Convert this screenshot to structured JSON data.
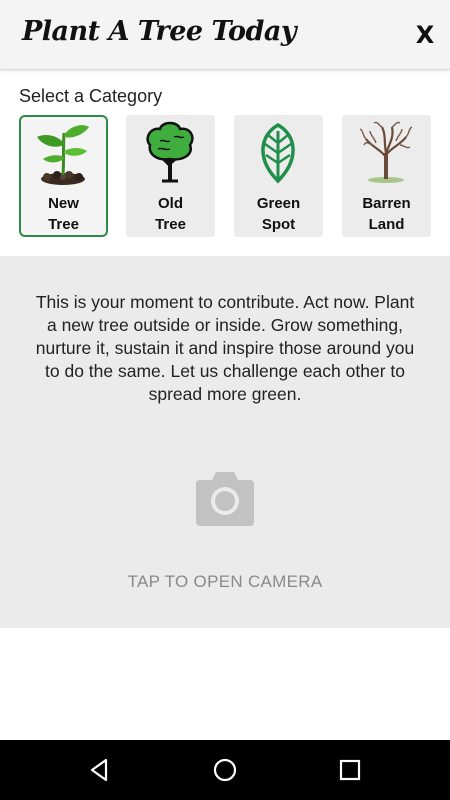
{
  "header": {
    "title": "Plant A Tree Today",
    "close_label": "X"
  },
  "category_section": {
    "label": "Select a Category",
    "selected": "New Tree",
    "items": [
      {
        "line1": "New",
        "line2": "Tree",
        "icon": "sprout-icon"
      },
      {
        "line1": "Old",
        "line2": "Tree",
        "icon": "tree-icon"
      },
      {
        "line1": "Green",
        "line2": "Spot",
        "icon": "leaf-icon"
      },
      {
        "line1": "Barren",
        "line2": "Land",
        "icon": "bare-tree-icon"
      }
    ]
  },
  "main": {
    "description": "This is your moment to contribute. Act now. Plant a new tree outside or inside. Grow something, nurture it, sustain it and inspire those around you to do the same. Let us challenge each other to spread more green.",
    "camera_icon": "camera-icon",
    "tap_label": "TAP TO OPEN CAMERA"
  },
  "colors": {
    "accent_green": "#2e8b46",
    "panel_gray": "#ebebeb",
    "muted_text": "#8a8a8a"
  },
  "navbar": {
    "icons": [
      "back-icon",
      "home-icon",
      "recents-icon"
    ]
  }
}
